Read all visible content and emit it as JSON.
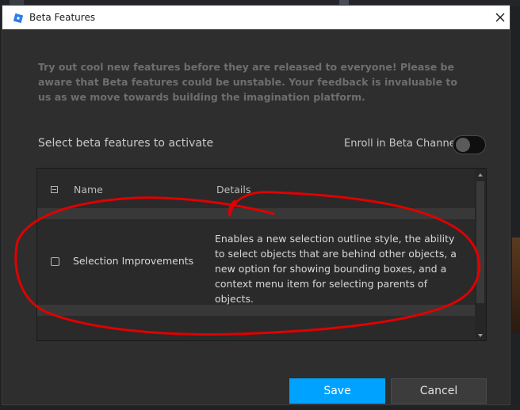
{
  "window": {
    "title": "Beta Features",
    "app_icon": "studio-logo-icon",
    "close_icon": "close-icon"
  },
  "intro_text": "Try out cool new features before they are released to everyone! Please be aware that Beta features could be unstable. Your feedback is invaluable to us as we move towards building the imagination platform.",
  "section_label": "Select beta features to activate",
  "enroll": {
    "label": "Enroll in Beta Channel",
    "enabled": false
  },
  "table": {
    "columns": [
      "Name",
      "Details"
    ],
    "rows": [
      {
        "name": "Selection Improvements",
        "details": "Enables a new selection outline style, the ability to select objects that are behind other objects, a new option for showing bounding boxes, and a context menu item for selecting parents of objects.",
        "checked": false
      }
    ]
  },
  "buttons": {
    "save": "Save",
    "cancel": "Cancel"
  },
  "colors": {
    "accent": "#00a2ff",
    "dialog_bg": "#2e2e2e",
    "annotation": "#e00000"
  }
}
